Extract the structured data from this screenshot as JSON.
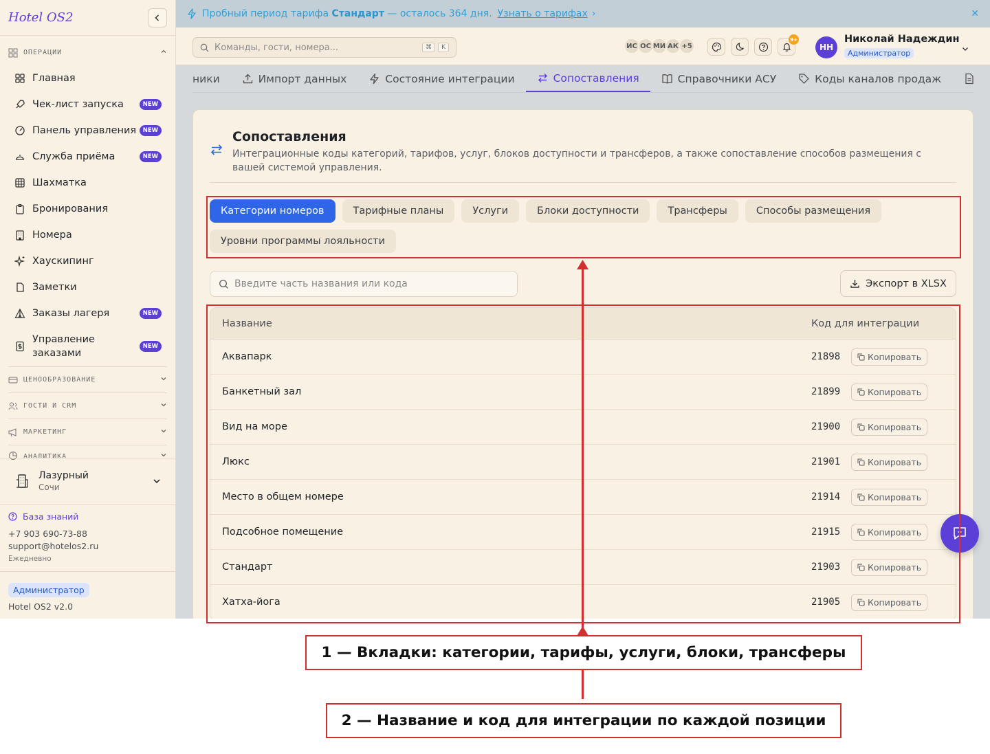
{
  "sidebar": {
    "brand": "Hotel OS2",
    "section_operations": "ОПЕРАЦИИ",
    "items": [
      {
        "label": "Главная",
        "icon": "grid-icon",
        "badge": ""
      },
      {
        "label": "Чек-лист запуска",
        "icon": "rocket-icon",
        "badge": "NEW"
      },
      {
        "label": "Панель управления",
        "icon": "gauge-icon",
        "badge": "NEW"
      },
      {
        "label": "Служба приёма",
        "icon": "bell-desk-icon",
        "badge": "NEW"
      },
      {
        "label": "Шахматка",
        "icon": "table-grid-icon",
        "badge": ""
      },
      {
        "label": "Бронирования",
        "icon": "clipboard-icon",
        "badge": ""
      },
      {
        "label": "Номера",
        "icon": "building-icon",
        "badge": ""
      },
      {
        "label": "Хаускипинг",
        "icon": "sparkles-icon",
        "badge": ""
      },
      {
        "label": "Заметки",
        "icon": "file-icon",
        "badge": ""
      },
      {
        "label": "Заказы лагеря",
        "icon": "tent-icon",
        "badge": "NEW"
      },
      {
        "label": "Управление заказами",
        "icon": "dollar-doc-icon",
        "badge": "NEW"
      }
    ],
    "sections": [
      "ЦЕНООБРАЗОВАНИЕ",
      "ГОСТИ И CRM",
      "МАРКЕТИНГ",
      "АНАЛИТИКА"
    ],
    "hotel": {
      "name": "Лазурный",
      "city": "Сочи"
    },
    "knowledge_base": "База знаний",
    "phone": "+7 903 690-73-88",
    "email": "support@hotelos2.ru",
    "schedule": "Ежедневно",
    "role": "Администратор",
    "version": "Hotel OS2 v2.0"
  },
  "banner": {
    "prefix": "Пробный период тарифа ",
    "plan": "Стандарт",
    "suffix": " — осталось 364 дня.",
    "link": "Узнать о тарифах",
    "link_arrow": "›",
    "close": "✕"
  },
  "topbar": {
    "search_placeholder": "Команды, гости, номера...",
    "kbd1": "⌘",
    "kbd2": "K",
    "avatars": [
      "ИС",
      "ОС",
      "МИ",
      "АК",
      "+5"
    ],
    "notif_count": "9+",
    "user_initials": "НН",
    "user_name": "Николай Надеждин",
    "user_role": "Администратор"
  },
  "tabs": [
    {
      "label": "ники",
      "icon": ""
    },
    {
      "label": "Импорт данных",
      "icon": "upload-icon"
    },
    {
      "label": "Состояние интеграции",
      "icon": "bolt-icon"
    },
    {
      "label": "Сопоставления",
      "icon": "swap-icon"
    },
    {
      "label": "Справочники АСУ",
      "icon": "book-icon"
    },
    {
      "label": "Коды каналов продаж",
      "icon": "tag-icon"
    }
  ],
  "card": {
    "title": "Сопоставления",
    "description": "Интеграционные коды категорий, тарифов, услуг, блоков доступности и трансферов, а также сопоставление способов размещения с вашей системой управления.",
    "pills": [
      "Категории номеров",
      "Тарифные планы",
      "Услуги",
      "Блоки доступности",
      "Трансферы",
      "Способы размещения",
      "Уровни программы лояльности"
    ],
    "search_placeholder": "Введите часть названия или кода",
    "export_label": "Экспорт в XLSX",
    "col_name": "Название",
    "col_code": "Код для интеграции",
    "copy_label": "Копировать",
    "rows": [
      {
        "name": "Аквапарк",
        "code": "21898"
      },
      {
        "name": "Банкетный зал",
        "code": "21899"
      },
      {
        "name": "Вид на море",
        "code": "21900"
      },
      {
        "name": "Люкс",
        "code": "21901"
      },
      {
        "name": "Место в общем номере",
        "code": "21914"
      },
      {
        "name": "Подсобное помещение",
        "code": "21915"
      },
      {
        "name": "Стандарт",
        "code": "21903"
      },
      {
        "name": "Хатха-йога",
        "code": "21905"
      }
    ]
  },
  "annotations": {
    "label1": "1 — Вкладки: категории, тарифы, услуги, блоки, трансферы",
    "label2": "2 — Название и код для интеграции по каждой позиции"
  },
  "colors": {
    "accent": "#5b3fd6",
    "active_pill": "#2f66e8",
    "annotation": "#d22f2f",
    "sidebar_bg": "#f9f1e3"
  }
}
